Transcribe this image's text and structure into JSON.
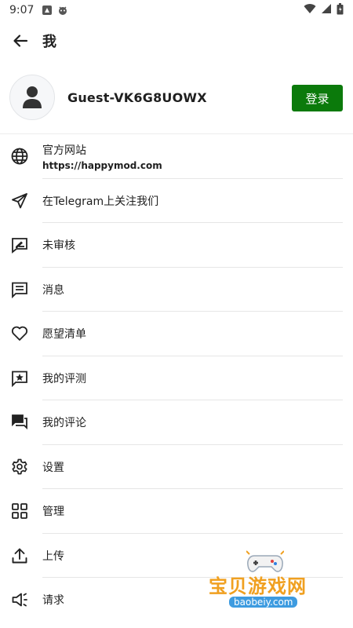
{
  "status_bar": {
    "time": "9:07"
  },
  "app_bar": {
    "title": "我"
  },
  "profile": {
    "username": "Guest-VK6G8UOWX",
    "login_label": "登录"
  },
  "colors": {
    "accent": "#0b7a0b",
    "divider": "#e6e6e6"
  },
  "menu": [
    {
      "label": "官方网站",
      "sub": "https://happymod.com",
      "icon": "globe-icon"
    },
    {
      "label": "在Telegram上关注我们",
      "icon": "telegram-icon"
    },
    {
      "label": "未审核",
      "icon": "unreviewed-icon"
    },
    {
      "label": "消息",
      "icon": "message-icon"
    },
    {
      "label": "愿望清单",
      "icon": "heart-icon"
    },
    {
      "label": "我的评测",
      "icon": "star-review-icon"
    },
    {
      "label": "我的评论",
      "icon": "comments-icon"
    },
    {
      "label": "设置",
      "icon": "gear-icon"
    },
    {
      "label": "管理",
      "icon": "grid-icon"
    },
    {
      "label": "上传",
      "icon": "upload-icon"
    },
    {
      "label": "请求",
      "icon": "megaphone-icon"
    }
  ],
  "watermark": {
    "title": "宝贝游戏网",
    "url": "baobeiy.com"
  }
}
